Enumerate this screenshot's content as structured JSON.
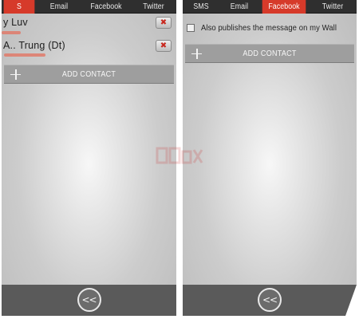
{
  "left_panel": {
    "tabs": [
      {
        "label": "S",
        "active": true
      },
      {
        "label": "Email",
        "active": false
      },
      {
        "label": "Facebook",
        "active": false
      },
      {
        "label": "Twitter",
        "active": false
      }
    ],
    "contacts": [
      {
        "name": "y Luv"
      },
      {
        "name": "A.. Trung (Dt)"
      }
    ],
    "remove_glyph": "✖",
    "add_contact_label": "ADD CONTACT",
    "back_label": "<<"
  },
  "right_panel": {
    "tabs": [
      {
        "label": "SMS",
        "active": false
      },
      {
        "label": "Email",
        "active": false
      },
      {
        "label": "Facebook",
        "active": true
      },
      {
        "label": "Twitter",
        "active": false
      }
    ],
    "wall_checkbox_label": "Also publishes the message on my Wall",
    "wall_checkbox_checked": false,
    "add_contact_label": "ADD CONTACT",
    "back_label": "<<"
  },
  "colors": {
    "active_tab": "#d63a2a",
    "tab_bar": "#2f2f2f",
    "footer": "#5a5a5a",
    "add_bar": "#9e9e9e"
  },
  "icons": {
    "add": "plus-icon",
    "remove": "close-icon",
    "back": "double-chevron-left-icon"
  }
}
